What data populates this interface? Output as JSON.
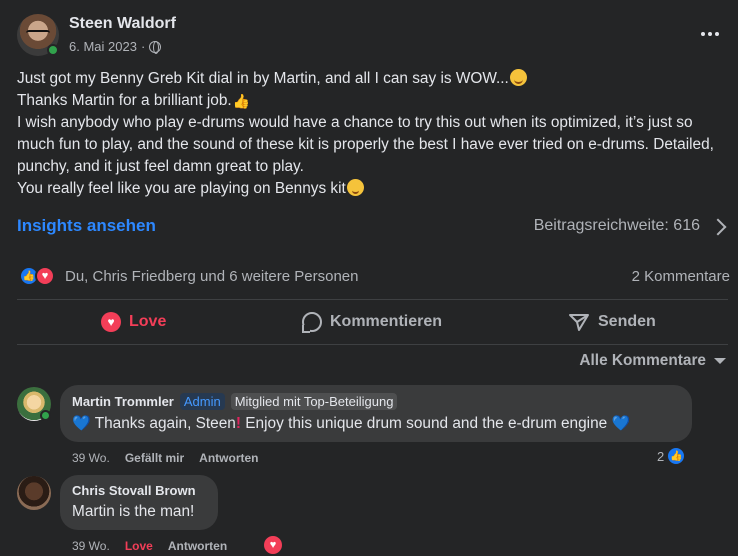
{
  "post": {
    "author": "Steen Waldorf",
    "date": "6. Mai 2023",
    "separator": "·",
    "lines": [
      "Just got my Benny Greb Kit dial in by Martin, and all I can say is WOW...",
      "Thanks Martin for a brilliant job.",
      "I wish anybody who play e-drums would have a chance to try this out when its optimized, it’s just so much fun to play, and the sound of these kit is properly the best I have ever tried on e-drums. Detailed, punchy, and it just feel damn great to play.",
      "You really feel like you are playing on Bennys kit"
    ],
    "emojis": [
      "smiling-face-icon",
      "thumbs-up-icon",
      "winking-face-icon"
    ]
  },
  "insights": {
    "link_label": "Insights ansehen",
    "reach_label": "Beitragsreichweite: 616"
  },
  "reactions": {
    "summary": "Du, Chris Friedberg und 6 weitere Personen",
    "comment_count": "2 Kommentare",
    "icons": [
      "like-icon",
      "love-icon"
    ]
  },
  "actions": {
    "love": "Love",
    "comment": "Kommentieren",
    "share": "Senden"
  },
  "comments_filter": {
    "label": "Alle Kommentare"
  },
  "comments": [
    {
      "name": "Martin Trommler",
      "badge_admin": "Admin",
      "badge_top": "Mitglied mit Top-Beteiligung",
      "text_part1": "Thanks again, Steen",
      "text_part2": "Enjoy this unique drum sound and the e-drum engine",
      "time": "39 Wo.",
      "like_label": "Gefällt mir",
      "reply_label": "Antworten",
      "reaction_count": "2"
    },
    {
      "name": "Chris Stovall Brown",
      "text": "Martin is the man!",
      "time": "39 Wo.",
      "like_label": "Love",
      "reply_label": "Antworten"
    }
  ],
  "colors": {
    "background": "#242526",
    "bubble": "#3a3b3c",
    "link_blue": "#2d88ff",
    "love_red": "#f33e58",
    "online_green": "#31a24c"
  }
}
